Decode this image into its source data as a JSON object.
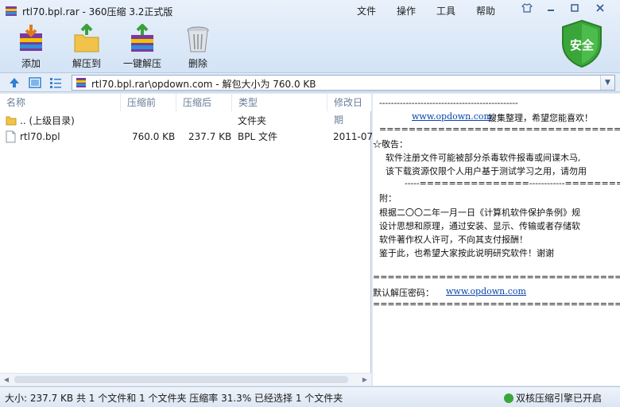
{
  "window": {
    "title": "rtl70.bpl.rar - 360压缩 3.2正式版"
  },
  "menu": {
    "file": "文件",
    "operation": "操作",
    "tools": "工具",
    "help": "帮助"
  },
  "toolbar": {
    "add": "添加",
    "extract_to": "解压到",
    "one_click_extract": "一键解压",
    "delete": "删除"
  },
  "security_badge": "安全",
  "address": {
    "text": "rtl70.bpl.rar\\opdown.com - 解包大小为 760.0 KB"
  },
  "columns": {
    "name": "名称",
    "packed": "压缩前",
    "unpacked": "压缩后",
    "type": "类型",
    "modified": "修改日期"
  },
  "files": [
    {
      "name": ".. (上级目录)",
      "packed": "",
      "unpacked": "",
      "type": "文件夹",
      "modified": ""
    },
    {
      "name": "rtl70.bpl",
      "packed": "760.0 KB",
      "unpacked": "237.7 KB",
      "type": "BPL 文件",
      "modified": "2011-07"
    }
  ],
  "comment": {
    "rule1": "-----------------------------------------------",
    "line1_link": "www.opdown.com",
    "line1_rest": "搜集整理，希望您能喜欢！",
    "rule2": "===============================================",
    "warn_title": "☆敬告：",
    "warn1": "软件注册文件可能被部分杀毒软件报毒或间谍木马,",
    "warn2": "该下载资源仅限个人用户基于测试学习之用，请勿用",
    "rule3": "-----===============------------==========",
    "note_title": "附：",
    "note1": "根据二〇〇二年一月一日《计算机软件保护条例》规",
    "note2": "设计思想和原理，通过安装、显示、传输或者存储软",
    "note3": "软件著作权人许可，不向其支付报酬！",
    "note4": "鉴于此，也希望大家按此说明研究软件！谢谢",
    "rule4": "===============================================",
    "pwd_label": "默认解压密码：",
    "pwd_link": "www.opdown.com",
    "rule5": "==============================================="
  },
  "status": {
    "text": "大小: 237.7 KB 共 1 个文件和 1 个文件夹 压缩率 31.3% 已经选择 1 个文件夹",
    "engine": "双核压缩引擎已开启"
  }
}
